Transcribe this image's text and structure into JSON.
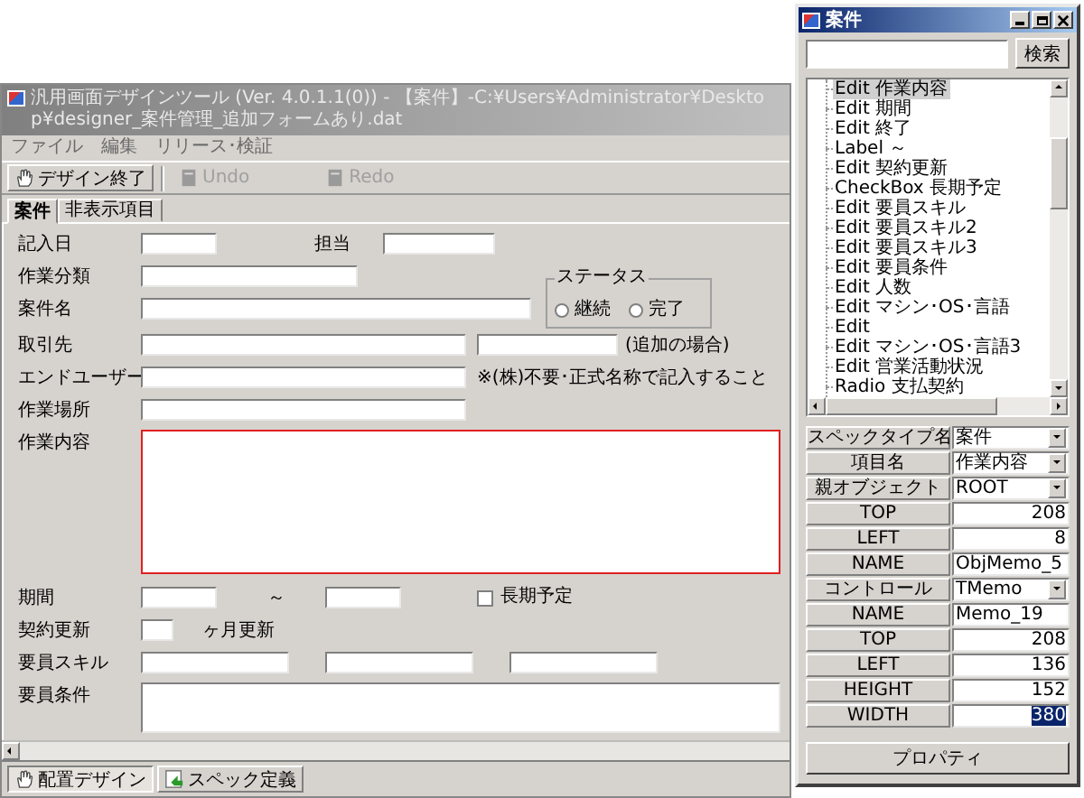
{
  "main_window": {
    "title": "汎用画面デザインツール (Ver. 4.0.1.1(0)) - 【案件】-C:¥Users¥Administrator¥Desktop¥designer_案件管理_追加フォームあり.dat"
  },
  "menu": [
    "ファイル",
    "編集",
    "リリース･検証"
  ],
  "toolbar": [
    {
      "label": "デザイン終了",
      "disabled": false
    },
    {
      "label": "Undo",
      "disabled": true
    },
    {
      "label": "Redo",
      "disabled": true
    }
  ],
  "tabs": [
    {
      "label": "案件",
      "selected": true
    },
    {
      "label": "非表示項目",
      "selected": false
    }
  ],
  "form": {
    "entry_date": {
      "label": "記入日"
    },
    "assignee": {
      "label": "担当"
    },
    "work_category": {
      "label": "作業分類"
    },
    "project_name": {
      "label": "案件名"
    },
    "status": {
      "legend": "ステータス",
      "options": [
        {
          "label": "継続",
          "selected": false
        },
        {
          "label": "完了",
          "selected": false
        }
      ]
    },
    "client": {
      "label": "取引先",
      "note": "(追加の場合)"
    },
    "end_user": {
      "label": "エンドユーザー",
      "note": "※(株)不要･正式名称で記入すること"
    },
    "work_place": {
      "label": "作業場所"
    },
    "work_content": {
      "label": "作業内容",
      "selected": true
    },
    "period": {
      "label": "期間",
      "separator": "～",
      "long_term": {
        "label": "長期予定",
        "checked": false
      }
    },
    "renewal": {
      "label": "契約更新",
      "suffix": "ヶ月更新"
    },
    "staff_skills": {
      "label": "要員スキル"
    },
    "staff_conditions": {
      "label": "要員条件"
    }
  },
  "bottom_tabs": [
    {
      "label": "配置デザイン",
      "selected": true
    },
    {
      "label": "スペック定義",
      "selected": false
    }
  ],
  "panel": {
    "title": "案件",
    "search_button": "検索",
    "tree": [
      {
        "label": "Edit 作業内容",
        "selected": true
      },
      {
        "label": "Edit 期間",
        "selected": false
      },
      {
        "label": "Edit 終了",
        "selected": false
      },
      {
        "label": "Label ～",
        "selected": false
      },
      {
        "label": "Edit 契約更新",
        "selected": false
      },
      {
        "label": "CheckBox 長期予定",
        "selected": false
      },
      {
        "label": "Edit 要員スキル",
        "selected": false
      },
      {
        "label": "Edit 要員スキル2",
        "selected": false
      },
      {
        "label": "Edit 要員スキル3",
        "selected": false
      },
      {
        "label": "Edit 要員条件",
        "selected": false
      },
      {
        "label": "Edit 人数",
        "selected": false
      },
      {
        "label": "Edit マシン･OS･言語",
        "selected": false
      },
      {
        "label": "Edit",
        "selected": false
      },
      {
        "label": "Edit マシン･OS･言語3",
        "selected": false
      },
      {
        "label": "Edit 営業活動状況",
        "selected": false
      },
      {
        "label": "Radio 支払契約",
        "selected": false
      }
    ],
    "properties": [
      {
        "name": "スペックタイプ名",
        "value": "案件",
        "kind": "select",
        "highlighted": false
      },
      {
        "name": "項目名",
        "value": "作業内容",
        "kind": "select",
        "highlighted": false
      },
      {
        "name": "親オブジェクト",
        "value": "ROOT",
        "kind": "select",
        "highlighted": false
      },
      {
        "name": "TOP",
        "value": "208",
        "kind": "number",
        "highlighted": false
      },
      {
        "name": "LEFT",
        "value": "8",
        "kind": "number",
        "highlighted": false
      },
      {
        "name": "NAME",
        "value": "ObjMemo_5",
        "kind": "text",
        "highlighted": false
      },
      {
        "name": "コントロール",
        "value": "TMemo",
        "kind": "select",
        "highlighted": false
      },
      {
        "name": "NAME",
        "value": "Memo_19",
        "kind": "text",
        "highlighted": false
      },
      {
        "name": "TOP",
        "value": "208",
        "kind": "number",
        "highlighted": false
      },
      {
        "name": "LEFT",
        "value": "136",
        "kind": "number",
        "highlighted": false
      },
      {
        "name": "HEIGHT",
        "value": "152",
        "kind": "number",
        "highlighted": false
      },
      {
        "name": "WIDTH",
        "value": "380",
        "kind": "number",
        "highlighted": true
      }
    ],
    "button": "プロパティ"
  }
}
